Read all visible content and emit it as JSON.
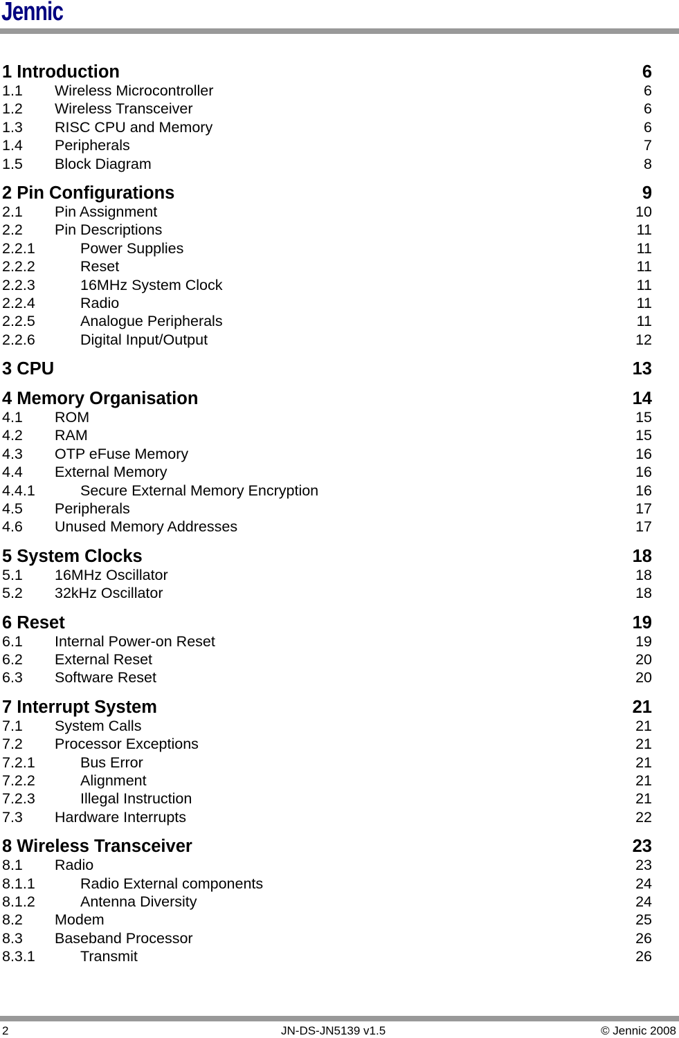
{
  "header": {
    "logo": "Jennic"
  },
  "toc": [
    {
      "level": 0,
      "num": "1",
      "title": "Introduction",
      "page": "6"
    },
    {
      "level": 1,
      "num": "1.1",
      "title": "Wireless Microcontroller",
      "page": "6"
    },
    {
      "level": 1,
      "num": "1.2",
      "title": "Wireless Transceiver",
      "page": "6"
    },
    {
      "level": 1,
      "num": "1.3",
      "title": "RISC CPU and Memory",
      "page": "6"
    },
    {
      "level": 1,
      "num": "1.4",
      "title": "Peripherals",
      "page": "7"
    },
    {
      "level": 1,
      "num": "1.5",
      "title": "Block Diagram",
      "page": "8"
    },
    {
      "level": 0,
      "num": "2",
      "title": "Pin Configurations",
      "page": "9"
    },
    {
      "level": 1,
      "num": "2.1",
      "title": "Pin Assignment",
      "page": "10"
    },
    {
      "level": 1,
      "num": "2.2",
      "title": "Pin Descriptions",
      "page": "11"
    },
    {
      "level": 2,
      "num": "2.2.1",
      "title": "Power Supplies",
      "page": "11"
    },
    {
      "level": 2,
      "num": "2.2.2",
      "title": "Reset",
      "page": "11"
    },
    {
      "level": 2,
      "num": "2.2.3",
      "title": "16MHz System Clock",
      "page": "11"
    },
    {
      "level": 2,
      "num": "2.2.4",
      "title": "Radio",
      "page": "11"
    },
    {
      "level": 2,
      "num": "2.2.5",
      "title": "Analogue Peripherals",
      "page": "11"
    },
    {
      "level": 2,
      "num": "2.2.6",
      "title": "Digital Input/Output",
      "page": "12"
    },
    {
      "level": 0,
      "num": "3",
      "title": "CPU",
      "page": "13"
    },
    {
      "level": 0,
      "num": "4",
      "title": "Memory Organisation",
      "page": "14"
    },
    {
      "level": 1,
      "num": "4.1",
      "title": "ROM",
      "page": "15"
    },
    {
      "level": 1,
      "num": "4.2",
      "title": "RAM",
      "page": "15"
    },
    {
      "level": 1,
      "num": "4.3",
      "title": "OTP eFuse Memory",
      "page": "16"
    },
    {
      "level": 1,
      "num": "4.4",
      "title": "External Memory",
      "page": "16"
    },
    {
      "level": 2,
      "num": "4.4.1",
      "title": "Secure External Memory Encryption",
      "page": "16"
    },
    {
      "level": 1,
      "num": "4.5",
      "title": "Peripherals",
      "page": "17"
    },
    {
      "level": 1,
      "num": "4.6",
      "title": "Unused Memory Addresses",
      "page": "17"
    },
    {
      "level": 0,
      "num": "5",
      "title": "System Clocks",
      "page": "18"
    },
    {
      "level": 1,
      "num": "5.1",
      "title": "16MHz Oscillator",
      "page": "18"
    },
    {
      "level": 1,
      "num": "5.2",
      "title": "32kHz Oscillator",
      "page": "18"
    },
    {
      "level": 0,
      "num": "6",
      "title": "Reset",
      "page": "19"
    },
    {
      "level": 1,
      "num": "6.1",
      "title": "Internal Power-on Reset",
      "page": "19"
    },
    {
      "level": 1,
      "num": "6.2",
      "title": "External Reset",
      "page": "20"
    },
    {
      "level": 1,
      "num": "6.3",
      "title": "Software Reset",
      "page": "20"
    },
    {
      "level": 0,
      "num": "7",
      "title": "Interrupt System",
      "page": "21"
    },
    {
      "level": 1,
      "num": "7.1",
      "title": "System Calls",
      "page": "21"
    },
    {
      "level": 1,
      "num": "7.2",
      "title": "Processor Exceptions",
      "page": "21"
    },
    {
      "level": 2,
      "num": "7.2.1",
      "title": "Bus Error",
      "page": "21"
    },
    {
      "level": 2,
      "num": "7.2.2",
      "title": "Alignment",
      "page": "21"
    },
    {
      "level": 2,
      "num": "7.2.3",
      "title": "Illegal Instruction",
      "page": "21"
    },
    {
      "level": 1,
      "num": "7.3",
      "title": "Hardware Interrupts",
      "page": "22"
    },
    {
      "level": 0,
      "num": "8",
      "title": "Wireless Transceiver",
      "page": "23"
    },
    {
      "level": 1,
      "num": "8.1",
      "title": "Radio",
      "page": "23"
    },
    {
      "level": 2,
      "num": "8.1.1",
      "title": "Radio External components",
      "page": "24"
    },
    {
      "level": 2,
      "num": "8.1.2",
      "title": "Antenna Diversity",
      "page": "24"
    },
    {
      "level": 1,
      "num": "8.2",
      "title": "Modem",
      "page": "25"
    },
    {
      "level": 1,
      "num": "8.3",
      "title": "Baseband Processor",
      "page": "26"
    },
    {
      "level": 2,
      "num": "8.3.1",
      "title": "Transmit",
      "page": "26"
    }
  ],
  "footer": {
    "page_number": "2",
    "doc_id": "JN-DS-JN5139 v1.5",
    "copyright": "© Jennic 2008"
  }
}
